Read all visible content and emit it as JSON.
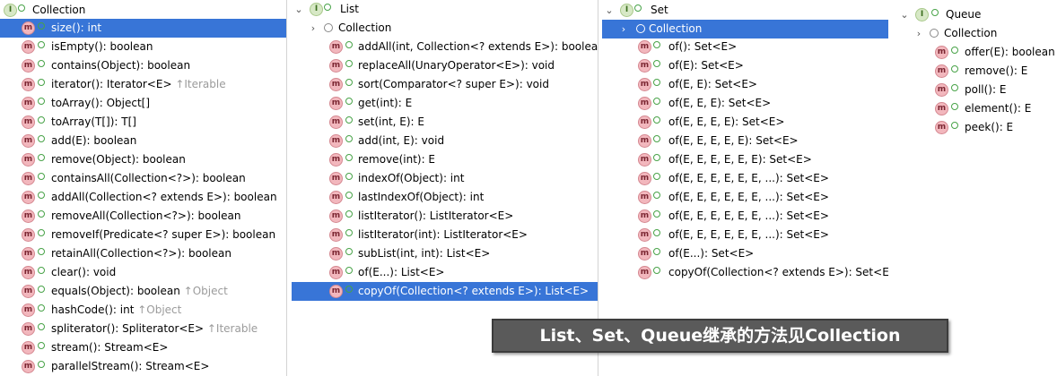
{
  "collection_panel": {
    "header": "Collection",
    "methods": [
      {
        "text": "size(): int",
        "selected": true
      },
      {
        "text": "isEmpty(): boolean"
      },
      {
        "text": "contains(Object): boolean"
      },
      {
        "text": "iterator(): Iterator<E>",
        "inherit": "↑Iterable"
      },
      {
        "text": "toArray(): Object[]"
      },
      {
        "text": "toArray(T[]): T[]"
      },
      {
        "text": "add(E): boolean"
      },
      {
        "text": "remove(Object): boolean"
      },
      {
        "text": "containsAll(Collection<?>): boolean"
      },
      {
        "text": "addAll(Collection<? extends E>): boolean"
      },
      {
        "text": "removeAll(Collection<?>): boolean"
      },
      {
        "text": "removeIf(Predicate<? super E>): boolean"
      },
      {
        "text": "retainAll(Collection<?>): boolean"
      },
      {
        "text": "clear(): void"
      },
      {
        "text": "equals(Object): boolean",
        "inherit": "↑Object"
      },
      {
        "text": "hashCode(): int",
        "inherit": "↑Object"
      },
      {
        "text": "spliterator(): Spliterator<E>",
        "inherit": "↑Iterable"
      },
      {
        "text": "stream(): Stream<E>"
      },
      {
        "text": "parallelStream(): Stream<E>"
      }
    ]
  },
  "list_panel": {
    "header": "List",
    "parent": "Collection",
    "methods": [
      {
        "text": "addAll(int, Collection<? extends E>): boolean"
      },
      {
        "text": "replaceAll(UnaryOperator<E>): void"
      },
      {
        "text": "sort(Comparator<? super E>): void"
      },
      {
        "text": "get(int): E"
      },
      {
        "text": "set(int, E): E"
      },
      {
        "text": "add(int, E): void"
      },
      {
        "text": "remove(int): E"
      },
      {
        "text": "indexOf(Object): int"
      },
      {
        "text": "lastIndexOf(Object): int"
      },
      {
        "text": "listIterator(): ListIterator<E>"
      },
      {
        "text": "listIterator(int): ListIterator<E>"
      },
      {
        "text": "subList(int, int): List<E>"
      },
      {
        "text": "of(E...): List<E>"
      },
      {
        "text": "copyOf(Collection<? extends E>): List<E>",
        "selected": true
      }
    ]
  },
  "set_panel": {
    "header": "Set",
    "parent": "Collection",
    "methods": [
      {
        "text": "of(): Set<E>"
      },
      {
        "text": "of(E): Set<E>"
      },
      {
        "text": "of(E, E): Set<E>"
      },
      {
        "text": "of(E, E, E): Set<E>"
      },
      {
        "text": "of(E, E, E, E): Set<E>"
      },
      {
        "text": "of(E, E, E, E, E): Set<E>"
      },
      {
        "text": "of(E, E, E, E, E, E): Set<E>"
      },
      {
        "text": "of(E, E, E, E, E, E, ...): Set<E>"
      },
      {
        "text": "of(E, E, E, E, E, E, ...): Set<E>"
      },
      {
        "text": "of(E, E, E, E, E, E, ...): Set<E>"
      },
      {
        "text": "of(E, E, E, E, E, E, ...): Set<E>"
      },
      {
        "text": "of(E...): Set<E>"
      },
      {
        "text": "copyOf(Collection<? extends E>): Set<E>"
      }
    ]
  },
  "queue_panel": {
    "header": "Queue",
    "parent": "Collection",
    "methods": [
      {
        "text": "offer(E): boolean"
      },
      {
        "text": "remove(): E"
      },
      {
        "text": "poll(): E"
      },
      {
        "text": "element(): E"
      },
      {
        "text": "peek(): E"
      }
    ]
  },
  "caption": "List、Set、Queue继承的方法见Collection",
  "colors": {
    "selection": "#3875d7",
    "interface_badge": "#d7e8c6",
    "method_badge": "#f2b7bd",
    "caption_bg": "#5a5a5a"
  },
  "icons": {
    "interface": "interface-icon",
    "method": "method-icon",
    "expand": "chevron-right-icon",
    "collapse": "chevron-down-icon"
  }
}
